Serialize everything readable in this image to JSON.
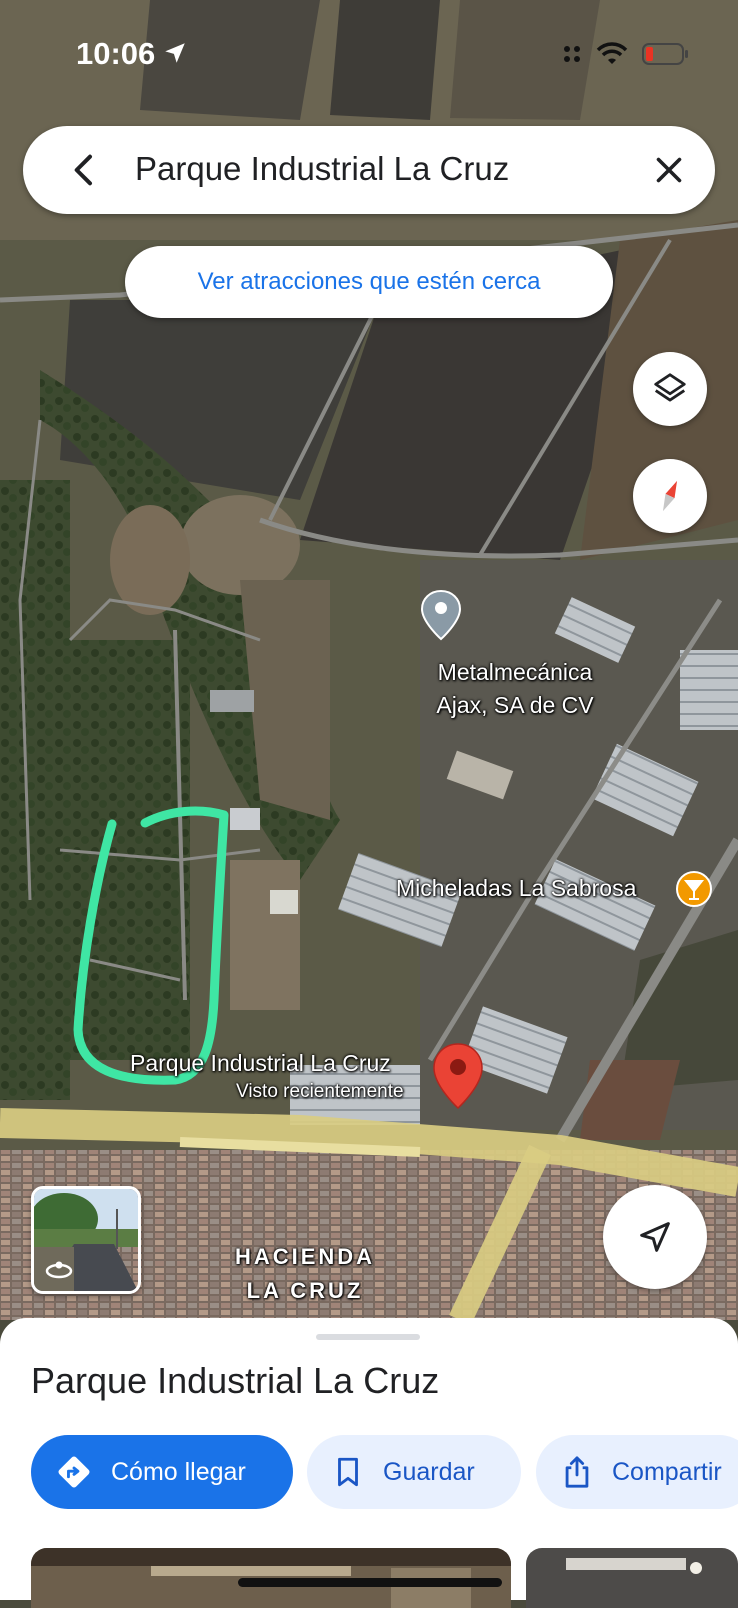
{
  "status_bar": {
    "time": "10:06"
  },
  "search": {
    "query": "Parque Industrial La Cruz"
  },
  "nearby_chip": {
    "label": "Ver atracciones que estén cerca"
  },
  "map": {
    "labels": {
      "metalmecanica": [
        "Metalmecánica",
        "Ajax, SA de CV"
      ],
      "micheladas": "Micheladas La Sabrosa",
      "selected_place": "Parque Industrial La Cruz",
      "selected_subtitle": "Visto recientemente",
      "neighborhood": [
        "HACIENDA",
        "LA CRUZ"
      ]
    },
    "annotation_color": "#3fe6a4"
  },
  "sheet": {
    "title": "Parque Industrial La Cruz",
    "actions": {
      "directions": "Cómo llegar",
      "save": "Guardar",
      "share": "Compartir"
    }
  },
  "icons": [
    "back-icon",
    "close-icon",
    "layers-icon",
    "compass-icon",
    "my-location-icon",
    "directions-icon",
    "bookmark-icon",
    "share-icon",
    "wifi-icon",
    "battery-icon"
  ],
  "colors": {
    "accent": "#1a73e8",
    "pin_red": "#ea4335",
    "road_yellow": "#e6d98a"
  }
}
